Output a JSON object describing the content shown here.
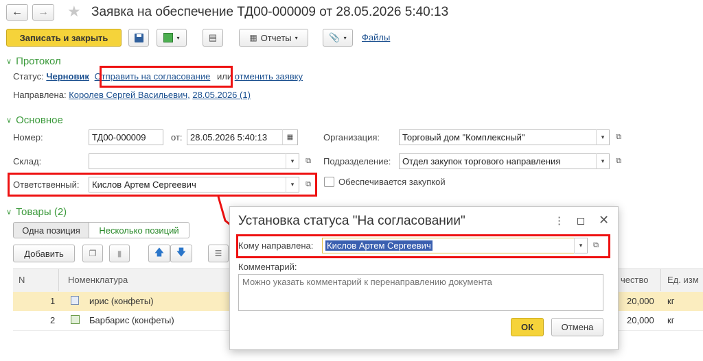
{
  "header": {
    "title": "Заявка на обеспечение ТД00-000009 от 28.05.2026 5:40:13",
    "back_icon": "arrow-left-icon",
    "forward_icon": "arrow-right-icon",
    "star_icon": "star-icon"
  },
  "toolbar": {
    "save_close": "Записать и закрыть",
    "reports": "Отчеты",
    "files": "Файлы"
  },
  "protocol": {
    "section_title": "Протокол",
    "status_label": "Статус:",
    "status_value": "Черновик",
    "send_link": "Отправить на согласование",
    "or_text": "или",
    "cancel_link": "отменить заявку",
    "directed_label": "Направлена:",
    "directed_person": "Королев Сергей Васильевич,",
    "directed_date": "28.05.2026 (1)"
  },
  "main": {
    "section_title": "Основное",
    "number_label": "Номер:",
    "number_value": "ТД00-000009",
    "from_label": "от:",
    "date_value": "28.05.2026  5:40:13",
    "org_label": "Организация:",
    "org_value": "Торговый дом \"Комплексный\"",
    "warehouse_label": "Склад:",
    "warehouse_value": "",
    "department_label": "Подразделение:",
    "department_value": "Отдел закупок торгового направления",
    "responsible_label": "Ответственный:",
    "responsible_value": "Кислов Артем Сергеевич",
    "procurement_checkbox": "Обеспечивается закупкой",
    "procurement_checked": false
  },
  "goods": {
    "section_title": "Товары (2)",
    "toggle_one": "Одна позиция",
    "toggle_many": "Несколько позиций",
    "add_button": "Добавить",
    "columns": {
      "n": "N",
      "nomenclature": "Номенклатура",
      "quantity": "чество",
      "unit": "Ед. изм"
    },
    "rows": [
      {
        "n": "1",
        "name": "ирис (конфеты)",
        "qty": "20,000",
        "unit": "кг",
        "selected": true
      },
      {
        "n": "2",
        "name": "Барбарис (конфеты)",
        "qty": "20,000",
        "unit": "кг",
        "selected": false
      }
    ]
  },
  "dialog": {
    "title": "Установка статуса \"На согласовании\"",
    "recipient_label": "Кому направлена:",
    "recipient_value": "Кислов Артем Сергеевич",
    "comment_label": "Комментарий:",
    "comment_placeholder": "Можно указать комментарий к перенаправлению документа",
    "ok": "ОК",
    "cancel": "Отмена"
  },
  "colors": {
    "accent_yellow": "#f5d33a",
    "section_green": "#3c9a3c",
    "link_blue": "#1a4f8f",
    "highlight_red": "#e11111",
    "selected_row": "#fbedbf"
  }
}
